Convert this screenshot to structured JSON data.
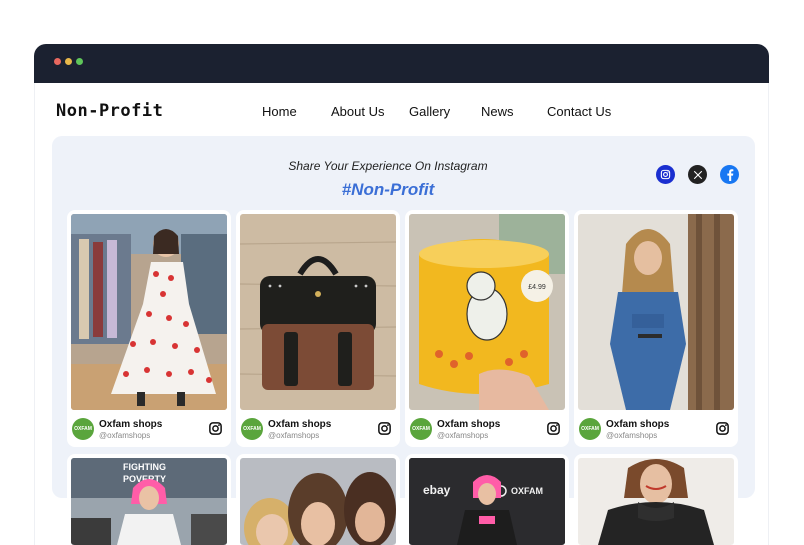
{
  "brand": "Non-Profit",
  "nav": [
    {
      "label": "Home"
    },
    {
      "label": "About Us"
    },
    {
      "label": "Gallery"
    },
    {
      "label": "News"
    },
    {
      "label": "Contact Us"
    }
  ],
  "feed": {
    "subtitle": "Share Your Experience On Instagram",
    "hashtag": "#Non-Profit",
    "social": [
      "instagram-icon",
      "x-icon",
      "facebook-icon"
    ]
  },
  "posts": [
    {
      "author": "Oxfam shops",
      "handle": "@oxfamshops",
      "avatar_text": "OXFAM"
    },
    {
      "author": "Oxfam shops",
      "handle": "@oxfamshops",
      "avatar_text": "OXFAM"
    },
    {
      "author": "Oxfam shops",
      "handle": "@oxfamshops",
      "avatar_text": "OXFAM"
    },
    {
      "author": "Oxfam shops",
      "handle": "@oxfamshops",
      "avatar_text": "OXFAM"
    }
  ],
  "photo_texts": {
    "fighting": "FIGHTING",
    "poverty": "POVERTY",
    "ebay": "ebay",
    "oxfam": "OXFAM",
    "price": "£4.99"
  },
  "colors": {
    "titlebar": "#1b2130",
    "panel": "#eef2f9",
    "hashtag": "#3b6fd6",
    "oxfam_green": "#5aa53c"
  }
}
